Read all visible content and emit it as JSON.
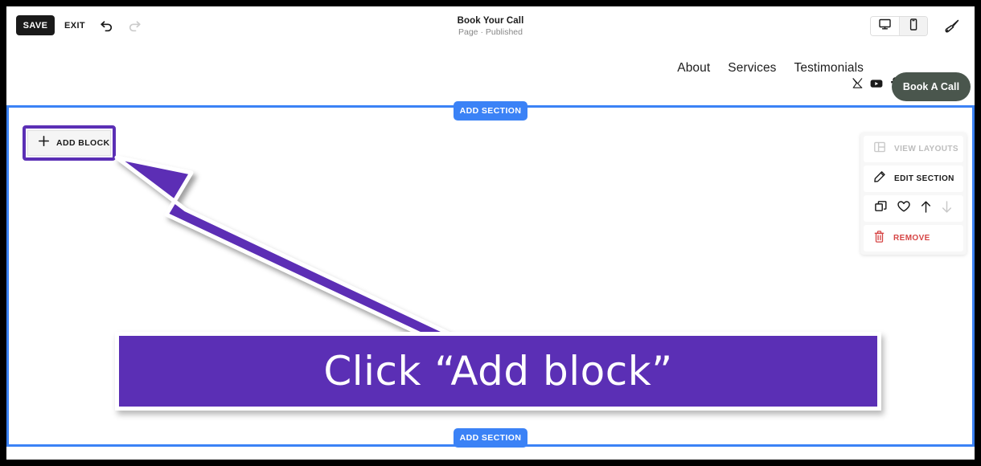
{
  "toolbar": {
    "save_label": "SAVE",
    "exit_label": "EXIT",
    "undo_icon": "undo-arrow-icon",
    "redo_icon": "redo-arrow-icon",
    "doc_title": "Book Your Call",
    "doc_subtitle": "Page · Published",
    "desktop_icon": "desktop-monitor-icon",
    "mobile_icon": "mobile-phone-icon",
    "brush_icon": "paintbrush-icon"
  },
  "site_nav": {
    "links": [
      {
        "label": "About"
      },
      {
        "label": "Services"
      },
      {
        "label": "Testimonials"
      }
    ],
    "socials": [
      {
        "icon": "x-twitter-icon"
      },
      {
        "icon": "youtube-icon"
      },
      {
        "icon": "facebook-icon"
      }
    ],
    "cta_label": "Book A Call",
    "cta_color": "#4a564d"
  },
  "canvas": {
    "add_section_top_label": "ADD SECTION",
    "add_section_bottom_label": "ADD SECTION",
    "add_block_label": "ADD BLOCK",
    "add_block_icon": "plus-icon",
    "section_border_color": "#3b82f6",
    "add_section_color": "#3b82f6",
    "highlight_color": "#5b2fb5"
  },
  "section_panel": {
    "rows": [
      {
        "label": "VIEW LAYOUTS",
        "icon": "layout-grid-icon",
        "disabled": true
      },
      {
        "label": "EDIT SECTION",
        "icon": "pencil-icon",
        "disabled": false
      }
    ],
    "icon_row": [
      {
        "icon": "duplicate-icon",
        "disabled": false
      },
      {
        "icon": "heart-icon",
        "disabled": false
      },
      {
        "icon": "arrow-up-icon",
        "disabled": false
      },
      {
        "icon": "arrow-down-icon",
        "disabled": true
      }
    ],
    "remove": {
      "label": "REMOVE",
      "icon": "trash-icon",
      "color": "#d64545"
    }
  },
  "callout": {
    "text": "Click “Add block”",
    "background": "#5b2fb5",
    "text_color": "#ffffff",
    "arrow_icon": "pointer-arrow-icon"
  }
}
